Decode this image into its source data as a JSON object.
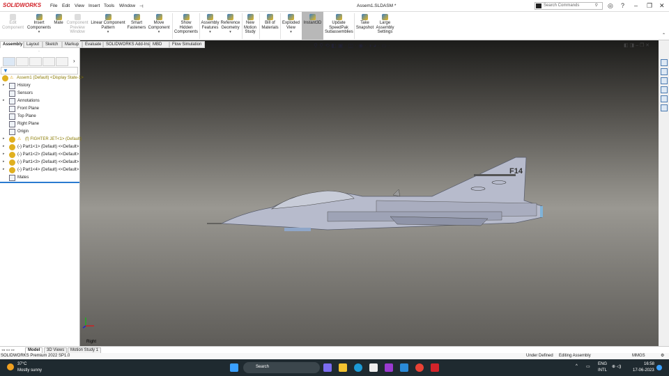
{
  "app": {
    "logo": "SOLIDWORKS",
    "title": "Assem1.SLDASM *",
    "search_placeholder": "Search Commands"
  },
  "menu": [
    "File",
    "Edit",
    "View",
    "Insert",
    "Tools",
    "Window"
  ],
  "ribbon": [
    {
      "label": "Edit Component",
      "disabled": true
    },
    {
      "label": "Insert Components"
    },
    {
      "label": "Mate"
    },
    {
      "label": "Component Preview Window",
      "disabled": true
    },
    {
      "label": "Linear Component Pattern"
    },
    {
      "label": "Smart Fasteners"
    },
    {
      "label": "Move Component"
    },
    {
      "label": "Show Hidden Components"
    },
    {
      "label": "Assembly Features"
    },
    {
      "label": "Reference Geometry"
    },
    {
      "label": "New Motion Study"
    },
    {
      "label": "Bill of Materials"
    },
    {
      "label": "Exploded View"
    },
    {
      "label": "Instant3D",
      "active": true
    },
    {
      "label": "Update SpeedPak Subassemblies"
    },
    {
      "label": "Take Snapshot"
    },
    {
      "label": "Large Assembly Settings"
    }
  ],
  "tabs": [
    "Assembly",
    "Layout",
    "Sketch",
    "Markup",
    "Evaluate",
    "SOLIDWORKS Add-Ins",
    "MBD",
    "Flow Simulation"
  ],
  "tree": [
    {
      "label": "Assem1 (Default) <Display State-1>",
      "warn": true,
      "type": "assembly"
    },
    {
      "label": "History",
      "arrow": true
    },
    {
      "label": "Sensors"
    },
    {
      "label": "Annotations",
      "arrow": true
    },
    {
      "label": "Front Plane"
    },
    {
      "label": "Top Plane"
    },
    {
      "label": "Right Plane"
    },
    {
      "label": "Origin"
    },
    {
      "label": "(f) FIGHTER JET<1> (Default)",
      "arrow": true,
      "warn": true,
      "type": "part"
    },
    {
      "label": "(-) Part1<1> (Default) <<Default>",
      "arrow": true,
      "type": "part"
    },
    {
      "label": "(-) Part1<2> (Default) <<Default>",
      "arrow": true,
      "type": "part"
    },
    {
      "label": "(-) Part1<3> (Default) <<Default>",
      "arrow": true,
      "type": "part"
    },
    {
      "label": "(-) Part1<4> (Default) <<Default>",
      "arrow": true,
      "type": "part"
    },
    {
      "label": "Mates"
    }
  ],
  "viewport": {
    "view_label": "Right",
    "tail_text": "F14"
  },
  "bottom_tabs": [
    "Model",
    "3D Views",
    "Motion Study 1"
  ],
  "status": {
    "product": "SOLIDWORKS Premium 2022 SP1.0",
    "state": "Under Defined",
    "mode": "Editing Assembly",
    "units": "MMGS"
  },
  "taskbar": {
    "temp": "37°C",
    "weather": "Mostly sunny",
    "search": "Search",
    "lang1": "ENG",
    "lang2": "INTL",
    "time": "16:58",
    "date": "17-06-2023"
  },
  "colors": {
    "accent": "#d2232a",
    "taskbar": "#1f2a30"
  }
}
